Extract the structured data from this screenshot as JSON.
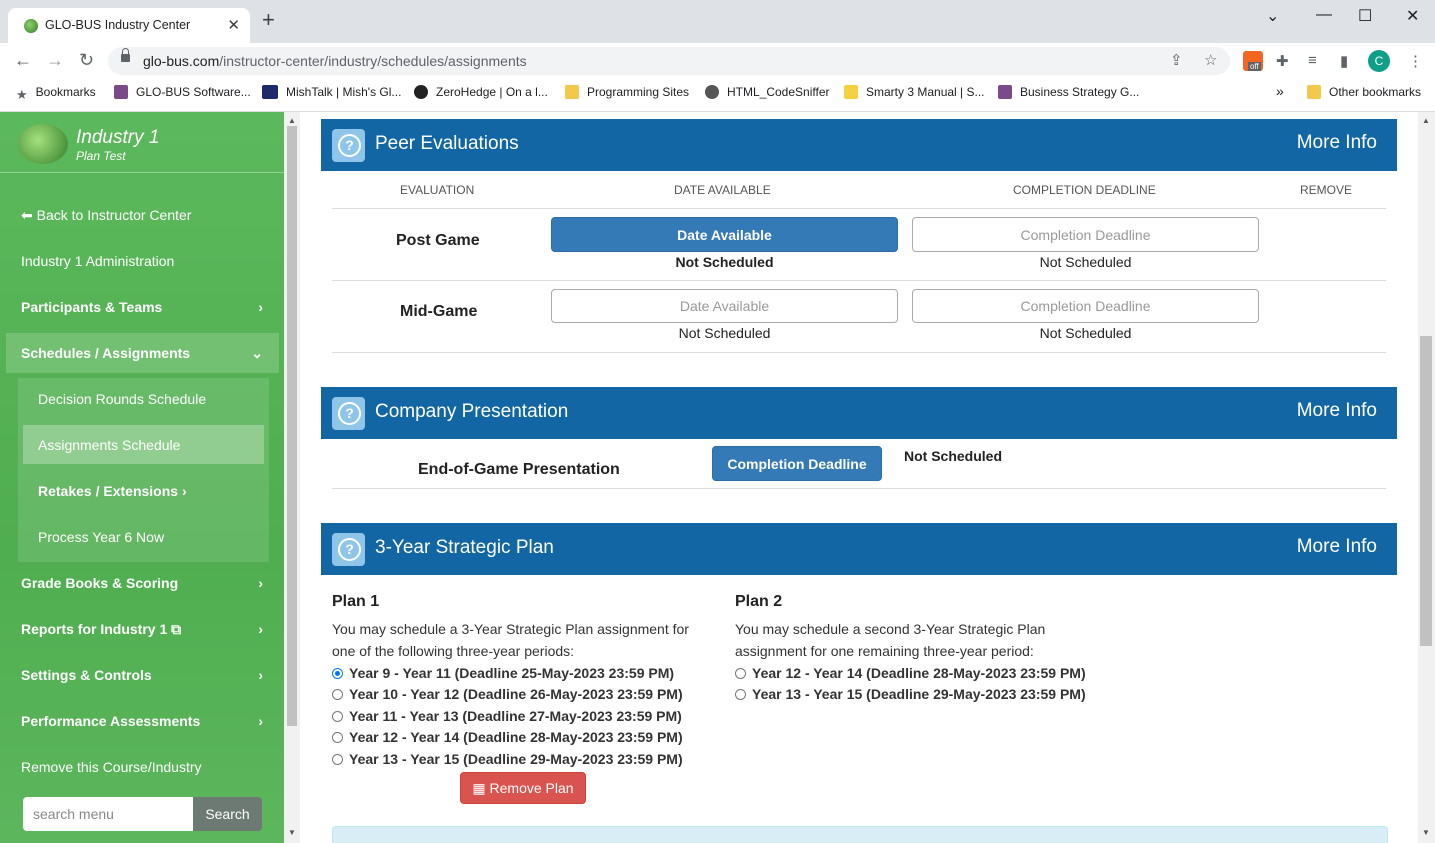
{
  "browser": {
    "tab_title": "GLO-BUS Industry Center",
    "url_host": "glo-bus.com",
    "url_path": "/instructor-center/industry/schedules/assignments",
    "bookmarks": [
      "Bookmarks",
      "GLO-BUS Software...",
      "MishTalk | Mish's Gl...",
      "ZeroHedge | On a l...",
      "Programming Sites",
      "HTML_CodeSniffer",
      "Smarty 3 Manual | S...",
      "Business Strategy G..."
    ],
    "other_bookmarks": "Other bookmarks",
    "avatar_letter": "C",
    "ext_badge": "off"
  },
  "sidebar": {
    "title": "Industry 1",
    "subtitle": "Plan Test",
    "back": "Back to Instructor Center",
    "admin": "Industry 1 Administration",
    "participants": "Participants & Teams",
    "schedules": "Schedules / Assignments",
    "decision_rounds": "Decision Rounds Schedule",
    "assignments_schedule": "Assignments Schedule",
    "retakes": "Retakes / Extensions",
    "process_year": "Process Year 6 Now",
    "grade_books": "Grade Books & Scoring",
    "reports": "Reports for Industry 1",
    "settings": "Settings & Controls",
    "performance": "Performance Assessments",
    "remove_course": "Remove this Course/Industry",
    "search_placeholder": "search menu",
    "search_button": "Search"
  },
  "peer_evaluations": {
    "title": "Peer Evaluations",
    "more_info": "More Info",
    "columns": [
      "EVALUATION",
      "DATE AVAILABLE",
      "COMPLETION DEADLINE",
      "REMOVE"
    ],
    "rows": [
      {
        "name": "Post Game",
        "date_button": "Date Available",
        "date_status": "Not Scheduled",
        "deadline_button": "Completion Deadline",
        "deadline_status": "Not Scheduled"
      },
      {
        "name": "Mid-Game",
        "date_button": "Date Available",
        "date_status": "Not Scheduled",
        "deadline_button": "Completion Deadline",
        "deadline_status": "Not Scheduled"
      }
    ]
  },
  "company_presentation": {
    "title": "Company Presentation",
    "more_info": "More Info",
    "row_name": "End-of-Game Presentation",
    "deadline_button": "Completion Deadline",
    "status": "Not Scheduled"
  },
  "strategic_plan": {
    "title": "3-Year Strategic Plan",
    "more_info": "More Info",
    "plan1": {
      "heading": "Plan 1",
      "description": "You may schedule a 3-Year Strategic Plan assignment for one of the following three-year periods:",
      "options": [
        {
          "label": "Year 9 - Year 11 (Deadline 25-May-2023 23:59 PM)",
          "checked": true
        },
        {
          "label": "Year 10 - Year 12 (Deadline 26-May-2023 23:59 PM)",
          "checked": false
        },
        {
          "label": "Year 11 - Year 13 (Deadline 27-May-2023 23:59 PM)",
          "checked": false
        },
        {
          "label": "Year 12 - Year 14 (Deadline 28-May-2023 23:59 PM)",
          "checked": false
        },
        {
          "label": "Year 13 - Year 15 (Deadline 29-May-2023 23:59 PM)",
          "checked": false
        }
      ],
      "remove_button": "Remove Plan"
    },
    "plan2": {
      "heading": "Plan 2",
      "description": "You may schedule a second 3-Year Strategic Plan assignment for one remaining three-year period:",
      "options": [
        {
          "label": "Year 12 - Year 14 (Deadline 28-May-2023 23:59 PM)",
          "checked": false
        },
        {
          "label": "Year 13 - Year 15 (Deadline 29-May-2023 23:59 PM)",
          "checked": false
        }
      ]
    }
  },
  "colors": {
    "sidebar_green": "#5cb85c",
    "panel_blue": "#1266a3",
    "primary": "#337ab7",
    "danger": "#d9534f"
  }
}
